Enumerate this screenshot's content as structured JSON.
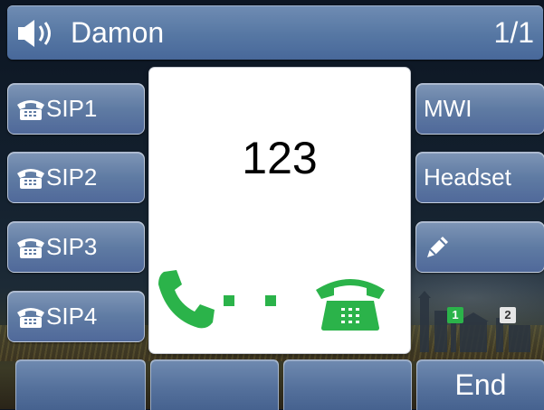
{
  "header": {
    "title": "Damon",
    "page_indicator": "1/1",
    "icon": "speaker-icon"
  },
  "line_keys_left": [
    {
      "label": "SIP1",
      "icon": "phone-icon"
    },
    {
      "label": "SIP2",
      "icon": "phone-icon"
    },
    {
      "label": "SIP3",
      "icon": "phone-icon"
    },
    {
      "label": "SIP4",
      "icon": "phone-icon"
    }
  ],
  "line_keys_right": [
    {
      "label": "MWI"
    },
    {
      "label": "Headset"
    },
    {
      "label": "",
      "icon": "pencil-icon"
    }
  ],
  "call": {
    "number": "123",
    "handset_icon": "handset-icon",
    "deskphone_icon": "desk-phone-icon",
    "accent_color": "#2bb34a"
  },
  "accounts": {
    "account_1": "1",
    "account_2": "2"
  },
  "softkeys": [
    "",
    "",
    "",
    "End"
  ],
  "colors": {
    "key_blue": "#5f7ba3",
    "call_green": "#2bb34a"
  }
}
